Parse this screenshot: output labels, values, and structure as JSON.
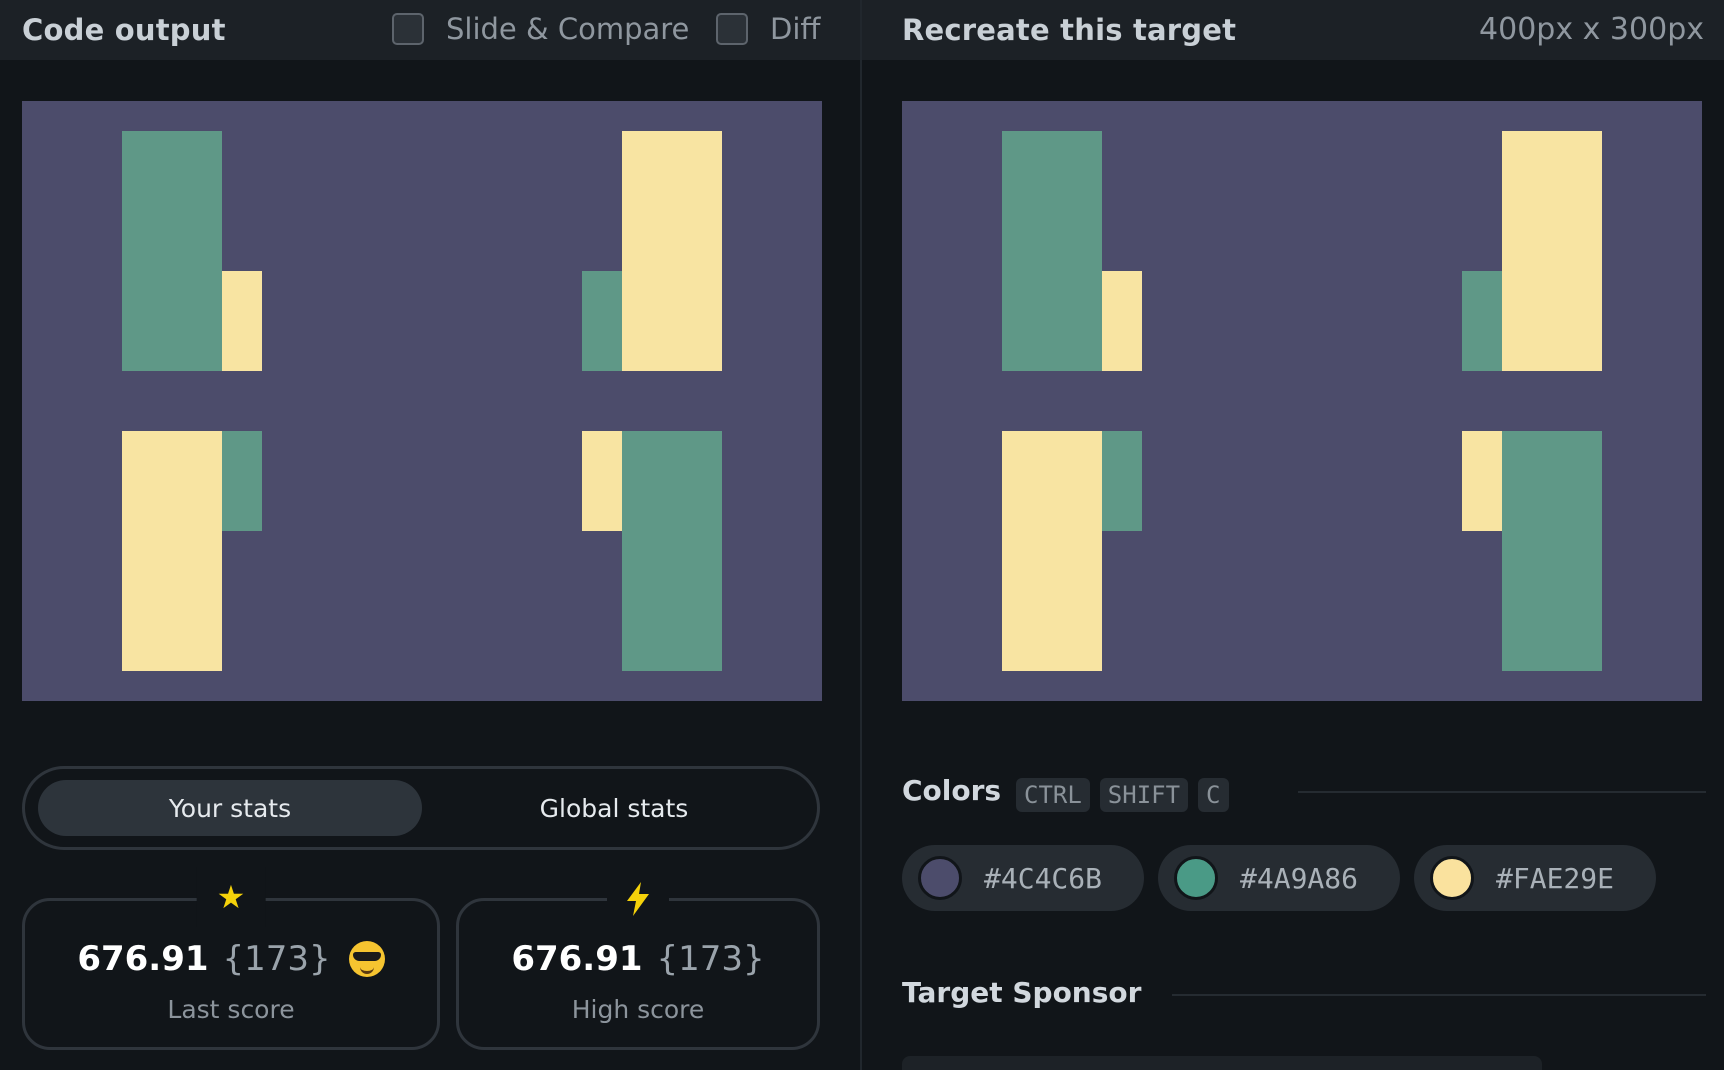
{
  "left_panel": {
    "title": "Code output",
    "slide_compare_label": "Slide & Compare",
    "diff_label": "Diff"
  },
  "right_panel": {
    "title": "Recreate this target",
    "target_size": "400px x 300px"
  },
  "canvas_colors": {
    "background": "#4C4C6B",
    "green": "#4A9A86",
    "yellow": "#FAE29E"
  },
  "stats": {
    "tabs": [
      "Your stats",
      "Global stats"
    ],
    "active_tab": "Your stats",
    "last": {
      "icon": "star-icon",
      "value": "676.91",
      "count": "{173}",
      "emoji": "sunglasses-emoji",
      "label": "Last score"
    },
    "high": {
      "icon": "lightning-icon",
      "value": "676.91",
      "count": "{173}",
      "label": "High score"
    }
  },
  "colors_section": {
    "title": "Colors",
    "shortcut_keys": [
      "CTRL",
      "SHIFT",
      "C"
    ],
    "swatches": [
      {
        "hex": "#4C4C6B"
      },
      {
        "hex": "#4A9A86"
      },
      {
        "hex": "#FAE29E"
      }
    ]
  },
  "sponsor_section": {
    "title": "Target Sponsor"
  }
}
